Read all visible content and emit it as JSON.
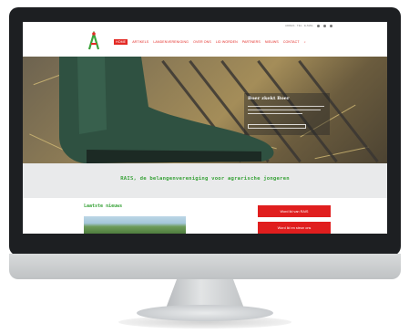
{
  "topbar": {
    "contact": "ADRES · TEL · E-MAIL"
  },
  "nav": {
    "items": [
      {
        "label": "HOME",
        "active": true
      },
      {
        "label": "ARTIKELS",
        "active": false
      },
      {
        "label": "LANDENVERENIGING",
        "active": false
      },
      {
        "label": "OVER ONS",
        "active": false
      },
      {
        "label": "LID WORDEN",
        "active": false
      },
      {
        "label": "PARTNERS",
        "active": false
      },
      {
        "label": "NIEUWS",
        "active": false
      },
      {
        "label": "CONTACT",
        "active": false
      }
    ]
  },
  "hero": {
    "title": "Boer zkekt Boer"
  },
  "tagline": "RAIS, de belangenvereniging voor agrarische jongeren",
  "news": {
    "title": "Laatste nieuws"
  },
  "sidebar": {
    "buttons": [
      "Word lid van RAIS",
      "Word lid en steun ons"
    ]
  },
  "colors": {
    "accent": "#e32a25",
    "green": "#3aa33a",
    "button": "#e01e1e"
  }
}
